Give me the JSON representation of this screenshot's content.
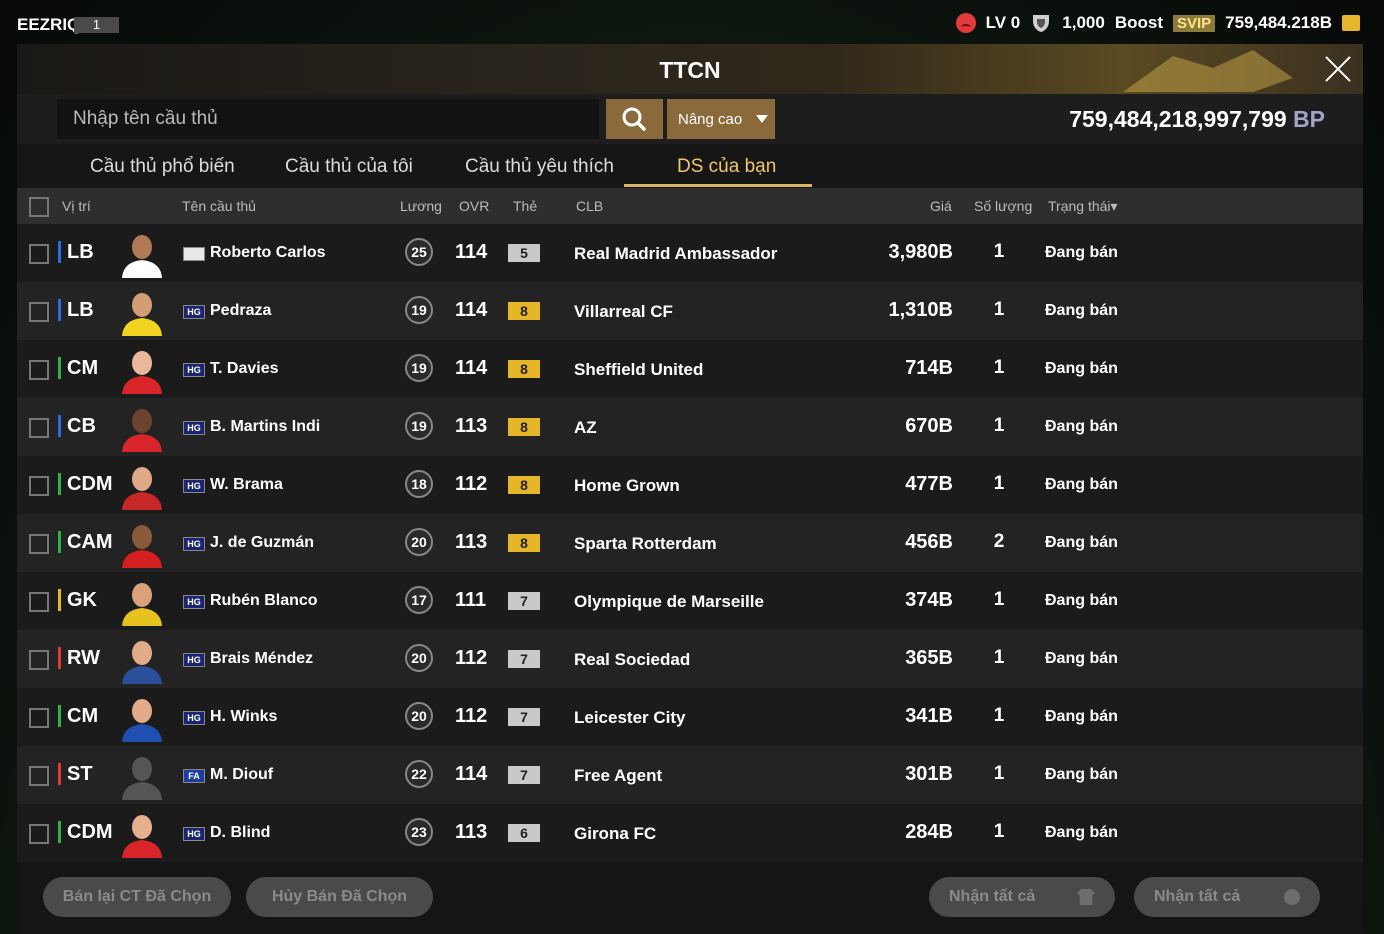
{
  "topbar": {
    "user_name": "EEZRIQ",
    "user_level": "1",
    "lv": "LV 0",
    "trophy_value": "1,000",
    "boost_label": "Boost",
    "svip_label": "SVIP",
    "currency": "759,484.218B"
  },
  "panel": {
    "title": "TTCN",
    "search_placeholder": "Nhập tên cầu thủ",
    "advanced_label": "Nâng cao",
    "bp_value": "759,484,218,997,799",
    "bp_unit": "BP"
  },
  "tabs": [
    {
      "label": "Cầu thủ phổ biến",
      "active": false
    },
    {
      "label": "Cầu thủ của tôi",
      "active": false
    },
    {
      "label": "Cầu thủ yêu thích",
      "active": false
    },
    {
      "label": "DS của bạn",
      "active": true
    }
  ],
  "columns": {
    "position": "Vị trí",
    "name": "Tên cầu thủ",
    "salary": "Lương",
    "ovr": "OVR",
    "card": "Thẻ",
    "club": "CLB",
    "price": "Giá",
    "quantity": "Số lượng",
    "status": "Trạng thái"
  },
  "players": [
    {
      "position": "LB",
      "pos_color": "#2a6fe0",
      "badge": "",
      "name": "Roberto Carlos",
      "salary": "25",
      "ovr": "114",
      "card": "5",
      "card_color": "#c9c9c9",
      "club": "Real Madrid Ambassador",
      "price": "3,980B",
      "quantity": "1",
      "status": "Đang bán",
      "shirt_color": "#ffffff",
      "skin": "#b07a55"
    },
    {
      "position": "LB",
      "pos_color": "#2a6fe0",
      "badge": "HG",
      "name": "Pedraza",
      "salary": "19",
      "ovr": "114",
      "card": "8",
      "card_color": "#e6b629",
      "club": "Villarreal CF",
      "price": "1,310B",
      "quantity": "1",
      "status": "Đang bán",
      "shirt_color": "#f2d420",
      "skin": "#d39d75"
    },
    {
      "position": "CM",
      "pos_color": "#2fb14a",
      "badge": "HG",
      "name": "T. Davies",
      "salary": "19",
      "ovr": "114",
      "card": "8",
      "card_color": "#e6b629",
      "club": "Sheffield United",
      "price": "714B",
      "quantity": "1",
      "status": "Đang bán",
      "shirt_color": "#d9252a",
      "skin": "#e9b89a"
    },
    {
      "position": "CB",
      "pos_color": "#2a6fe0",
      "badge": "HG",
      "name": "B. Martins Indi",
      "salary": "19",
      "ovr": "113",
      "card": "8",
      "card_color": "#e6b629",
      "club": "AZ",
      "price": "670B",
      "quantity": "1",
      "status": "Đang bán",
      "shirt_color": "#d9252a",
      "skin": "#6b4330"
    },
    {
      "position": "CDM",
      "pos_color": "#2fb14a",
      "badge": "HG",
      "name": "W. Brama",
      "salary": "18",
      "ovr": "112",
      "card": "8",
      "card_color": "#e6b629",
      "club": "Home Grown",
      "price": "477B",
      "quantity": "1",
      "status": "Đang bán",
      "shirt_color": "#c62828",
      "skin": "#e0a988"
    },
    {
      "position": "CAM",
      "pos_color": "#2fb14a",
      "badge": "HG",
      "name": "J. de Guzmán",
      "salary": "20",
      "ovr": "113",
      "card": "8",
      "card_color": "#e6b629",
      "club": "Sparta Rotterdam",
      "price": "456B",
      "quantity": "2",
      "status": "Đang bán",
      "shirt_color": "#d42020",
      "skin": "#8a5a3a"
    },
    {
      "position": "GK",
      "pos_color": "#e6b629",
      "badge": "HG",
      "name": "Rubén Blanco",
      "salary": "17",
      "ovr": "111",
      "card": "7",
      "card_color": "#c9c9c9",
      "club": "Olympique de Marseille",
      "price": "374B",
      "quantity": "1",
      "status": "Đang bán",
      "shirt_color": "#e5c21e",
      "skin": "#d9a27a"
    },
    {
      "position": "RW",
      "pos_color": "#e03a3a",
      "badge": "HG",
      "name": "Brais Méndez",
      "salary": "20",
      "ovr": "112",
      "card": "7",
      "card_color": "#c9c9c9",
      "club": "Real Sociedad",
      "price": "365B",
      "quantity": "1",
      "status": "Đang bán",
      "shirt_color": "#2b4f9a",
      "skin": "#e2ac8a"
    },
    {
      "position": "CM",
      "pos_color": "#2fb14a",
      "badge": "HG",
      "name": "H. Winks",
      "salary": "20",
      "ovr": "112",
      "card": "7",
      "card_color": "#c9c9c9",
      "club": "Leicester City",
      "price": "341B",
      "quantity": "1",
      "status": "Đang bán",
      "shirt_color": "#1f4fb0",
      "skin": "#e2ac8a"
    },
    {
      "position": "ST",
      "pos_color": "#e03a3a",
      "badge": "FA",
      "name": "M. Diouf",
      "salary": "22",
      "ovr": "114",
      "card": "7",
      "card_color": "#c9c9c9",
      "club": "Free Agent",
      "price": "301B",
      "quantity": "1",
      "status": "Đang bán",
      "shirt_color": "#555555",
      "skin": "#555555"
    },
    {
      "position": "CDM",
      "pos_color": "#2fb14a",
      "badge": "HG",
      "name": "D. Blind",
      "salary": "23",
      "ovr": "113",
      "card": "6",
      "card_color": "#c9c9c9",
      "club": "Girona FC",
      "price": "284B",
      "quantity": "1",
      "status": "Đang bán",
      "shirt_color": "#d9252a",
      "skin": "#e6b08e"
    }
  ],
  "footer": {
    "resell_label": "Bán lại CT Đã Chọn",
    "cancel_label": "Hủy Bán Đã Chọn",
    "claim_all_label_1": "Nhận tất cả",
    "claim_all_label_2": "Nhận tất cả"
  }
}
